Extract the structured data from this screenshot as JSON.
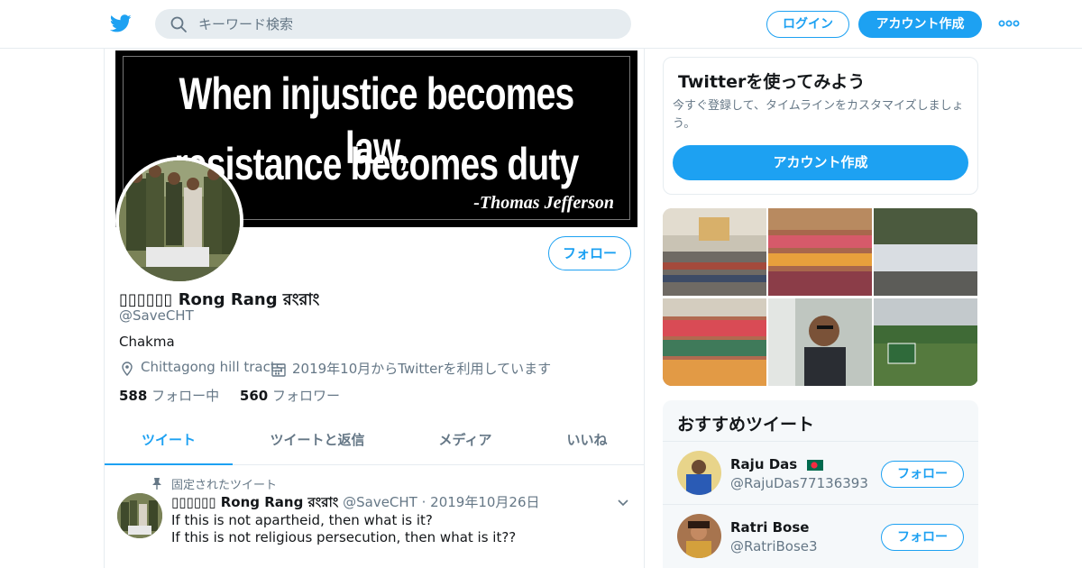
{
  "header": {
    "search_placeholder": "キーワード検索",
    "login_label": "ログイン",
    "signup_label": "アカウント作成",
    "logo_icon": "twitter-bird-icon",
    "more_icon": "more-dots-icon"
  },
  "colors": {
    "accent": "#1da1f2",
    "secondary_text": "#657786",
    "border": "#e6ecf0"
  },
  "profile": {
    "banner_lines": [
      "When injustice becomes law,",
      "resistance becomes duty",
      "-Thomas Jefferson"
    ],
    "name": "▯▯▯▯▯▯ Rong Rang রংরাং",
    "handle": "@SaveCHT",
    "bio": "Chakma",
    "location": "Chittagong hill tracts",
    "joined": "2019年10月からTwitterを利用しています",
    "following_count": "588",
    "following_label": "フォロー中",
    "followers_count": "560",
    "followers_label": "フォロワー",
    "follow_label": "フォロー"
  },
  "tabs": [
    {
      "label": "ツイート",
      "active": true
    },
    {
      "label": "ツイートと返信",
      "active": false
    },
    {
      "label": "メディア",
      "active": false
    },
    {
      "label": "いいね",
      "active": false
    }
  ],
  "pinned_tweet": {
    "pinned_label": "固定されたツイート",
    "name": "▯▯▯▯▯▯ Rong Rang রংরাং",
    "handle_date": "@SaveCHT · 2019年10月26日",
    "lines": [
      "If this is not apartheid, then what is it?",
      "If this is not religious persecution, then what is it??"
    ]
  },
  "sidebar": {
    "signup_card": {
      "title": "Twitterを使ってみよう",
      "text": "今すぐ登録して、タイムラインをカスタマイズしましょう。",
      "button": "アカウント作成"
    },
    "recommendations": {
      "title": "おすすめツイート",
      "items": [
        {
          "name": "Raju Das",
          "handle": "@RajuDas77136393",
          "follow": "フォロー",
          "flag_icon": "bangladesh-flag-icon"
        },
        {
          "name": "Ratri Bose",
          "handle": "@RatriBose3",
          "follow": "フォロー"
        }
      ]
    }
  }
}
